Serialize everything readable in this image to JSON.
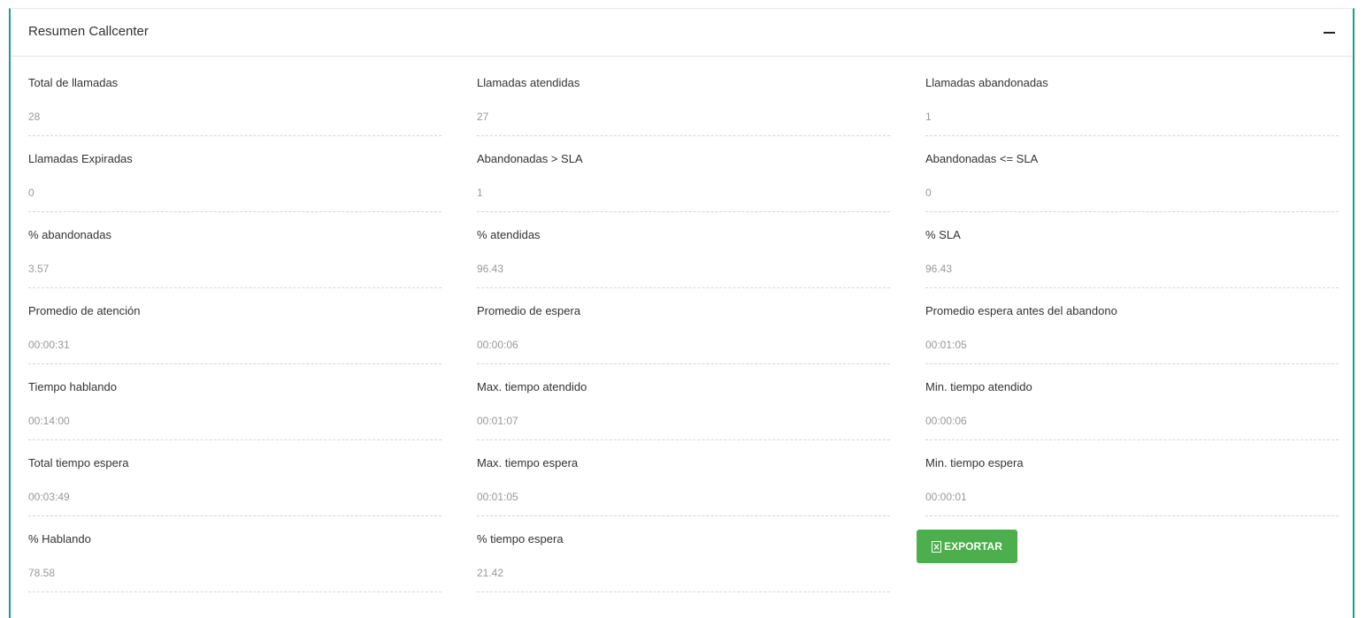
{
  "panel": {
    "title": "Resumen Callcenter",
    "collapse_icon": "minus-icon"
  },
  "fields": [
    {
      "id": "total-llamadas",
      "label": "Total de llamadas",
      "value": "28"
    },
    {
      "id": "llamadas-atendidas",
      "label": "Llamadas atendidas",
      "value": "27"
    },
    {
      "id": "llamadas-abandonadas",
      "label": "Llamadas abandonadas",
      "value": "1"
    },
    {
      "id": "llamadas-expiradas",
      "label": "Llamadas Expiradas",
      "value": "0"
    },
    {
      "id": "abandonadas-mayor-sla",
      "label": "Abandonadas > SLA",
      "value": "1"
    },
    {
      "id": "abandonadas-menor-igual-sla",
      "label": "Abandonadas <= SLA",
      "value": "0"
    },
    {
      "id": "pct-abandonadas",
      "label": "% abandonadas",
      "value": "3.57"
    },
    {
      "id": "pct-atendidas",
      "label": "% atendidas",
      "value": "96.43"
    },
    {
      "id": "pct-sla",
      "label": "% SLA",
      "value": "96.43"
    },
    {
      "id": "promedio-atencion",
      "label": "Promedio de atención",
      "value": "00:00:31"
    },
    {
      "id": "promedio-espera",
      "label": "Promedio de espera",
      "value": "00:00:06"
    },
    {
      "id": "promedio-espera-abandono",
      "label": "Promedio espera antes del abandono",
      "value": "00:01:05"
    },
    {
      "id": "tiempo-hablando",
      "label": "Tiempo hablando",
      "value": "00:14:00"
    },
    {
      "id": "max-tiempo-atendido",
      "label": "Max. tiempo atendido",
      "value": "00:01:07"
    },
    {
      "id": "min-tiempo-atendido",
      "label": "Min. tiempo atendido",
      "value": "00:00:06"
    },
    {
      "id": "total-tiempo-espera",
      "label": "Total tiempo espera",
      "value": "00:03:49"
    },
    {
      "id": "max-tiempo-espera",
      "label": "Max. tiempo espera",
      "value": "00:01:05"
    },
    {
      "id": "min-tiempo-espera",
      "label": "Min. tiempo espera",
      "value": "00:00:01"
    },
    {
      "id": "pct-hablando",
      "label": "% Hablando",
      "value": "78.58"
    },
    {
      "id": "pct-tiempo-espera",
      "label": "% tiempo espera",
      "value": "21.42"
    }
  ],
  "export_button": {
    "label": "EXPORTAR",
    "icon": "file-excel-icon",
    "color": "#4cae4c"
  },
  "colors": {
    "panel_border": "#1f9d8a",
    "value_text": "#999999"
  }
}
